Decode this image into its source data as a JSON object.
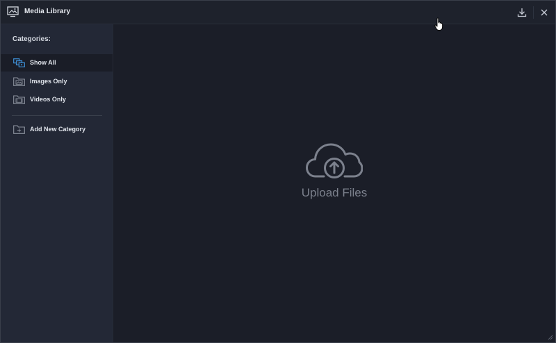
{
  "window": {
    "title": "Media Library"
  },
  "titlebar": {
    "download_icon": "download-icon",
    "close_icon": "close-icon"
  },
  "sidebar": {
    "heading": "Categories:",
    "items": [
      {
        "label": "Show All",
        "icon": "show-all-icon",
        "active": true
      },
      {
        "label": "Images Only",
        "icon": "image-folder-icon",
        "active": false
      },
      {
        "label": "Videos Only",
        "icon": "video-folder-icon",
        "active": false
      }
    ],
    "add_category": {
      "label": "Add New Category",
      "icon": "add-folder-icon"
    }
  },
  "main": {
    "upload_label": "Upload Files",
    "upload_icon": "cloud-upload-icon"
  },
  "colors": {
    "accent": "#3d8fd6",
    "sidebar_bg": "#232836",
    "content_bg": "#1b1e28",
    "muted_text": "#7c818d"
  }
}
